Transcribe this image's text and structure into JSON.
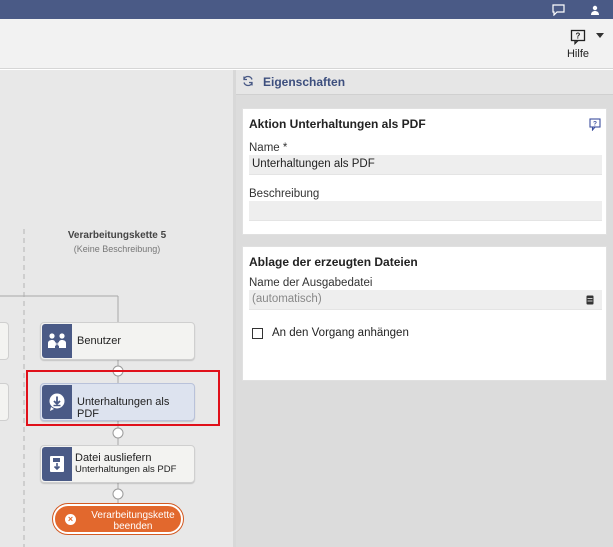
{
  "topbar": {
    "icons": [
      "chat-icon",
      "user-icon"
    ]
  },
  "toolbar": {
    "help_label": "Hilfe",
    "help_icon": "help-icon"
  },
  "panel": {
    "title": "Eigenschaften",
    "action_card": {
      "title": "Aktion Unterhaltungen als PDF",
      "name_label": "Name *",
      "name_value": "Unterhaltungen als PDF",
      "description_label": "Beschreibung",
      "description_value": ""
    },
    "storage_card": {
      "title": "Ablage der erzeugten Dateien",
      "filename_label": "Name der Ausgabedatei",
      "filename_placeholder": "(automatisch)",
      "attach_label": "An den Vorgang anhängen",
      "attach_checked": false
    }
  },
  "canvas": {
    "chain_title": "Verarbeitungskette 5",
    "chain_subtitle": "(Keine Beschreibung)",
    "nodes": [
      {
        "label": "Benutzer",
        "icon": "users-icon"
      },
      {
        "label": "Unterhaltungen als PDF",
        "icon": "download-bubble-icon",
        "selected": true
      },
      {
        "label": "Datei ausliefern",
        "sublabel": "Unterhaltungen als PDF",
        "icon": "save-file-icon"
      }
    ],
    "end_label_line1": "Verarbeitungskette",
    "end_label_line2": "beenden"
  },
  "colors": {
    "topbar": "#4a5a86",
    "accent": "#4a5a86",
    "end_button": "#e2682d",
    "highlight": "#e0101a"
  }
}
